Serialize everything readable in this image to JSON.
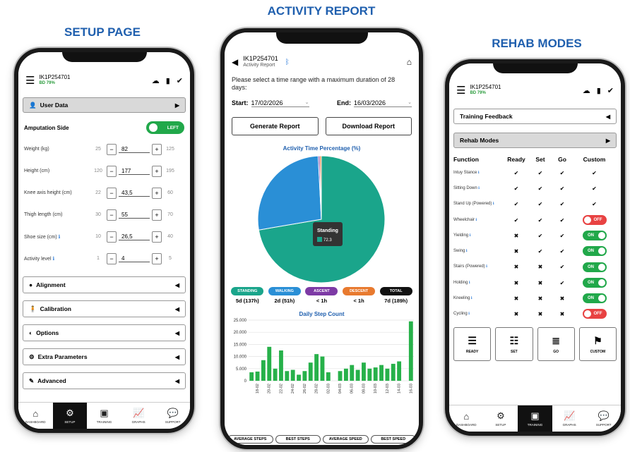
{
  "titles": {
    "setup": "SETUP PAGE",
    "activity": "ACTIVITY REPORT",
    "rehab": "REHAB MODES"
  },
  "device": {
    "id": "IK1P254701",
    "battery": "BD 79%"
  },
  "setup": {
    "user_data": "User Data",
    "amputation_side_label": "Amputation Side",
    "amputation_side_value": "LEFT",
    "params": [
      {
        "label": "Weight (kg)",
        "min": "25",
        "value": "82",
        "max": "125",
        "info": false
      },
      {
        "label": "Height (cm)",
        "min": "120",
        "value": "177",
        "max": "195",
        "info": false
      },
      {
        "label": "Knee axis height (cm)",
        "min": "22",
        "value": "43,5",
        "max": "60",
        "info": false
      },
      {
        "label": "Thigh length (cm)",
        "min": "30",
        "value": "55",
        "max": "70",
        "info": false
      },
      {
        "label": "Shoe size (cm)",
        "min": "10",
        "value": "26,5",
        "max": "40",
        "info": true
      },
      {
        "label": "Activity level",
        "min": "1",
        "value": "4",
        "max": "5",
        "info": true
      }
    ],
    "sections": [
      "Alignment",
      "Calibration",
      "Options",
      "Extra Parameters",
      "Advanced"
    ]
  },
  "nav": [
    {
      "label": "DASHBOARD",
      "icon": "home-icon"
    },
    {
      "label": "SETUP",
      "icon": "gear-icon"
    },
    {
      "label": "TRAINING",
      "icon": "training-icon"
    },
    {
      "label": "GRAPHS",
      "icon": "graph-icon"
    },
    {
      "label": "SUPPORT",
      "icon": "chat-icon"
    }
  ],
  "activity": {
    "subtitle": "Activity Report",
    "prompt": "Please select a time range with a maximum duration of 28 days:",
    "start_label": "Start:",
    "start_value": "17/02/2026",
    "end_label": "End:",
    "end_value": "16/03/2026",
    "generate": "Generate Report",
    "download": "Download Report",
    "pie_title": "Activity Time Percentage (%)",
    "tooltip_label": "Standing",
    "tooltip_value": "72.3",
    "summary": [
      {
        "label": "STANDING",
        "value": "5d (137h)",
        "color": "#1aa58b"
      },
      {
        "label": "WALKING",
        "value": "2d (51h)",
        "color": "#2a8fd6"
      },
      {
        "label": "ASCENT",
        "value": "< 1h",
        "color": "#7d3aa5"
      },
      {
        "label": "DESCENT",
        "value": "< 1h",
        "color": "#e87a2f"
      },
      {
        "label": "TOTAL",
        "value": "7d (189h)",
        "color": "#111111"
      }
    ],
    "bar_title": "Daily Step Count",
    "bottom_tabs": [
      "AVERAGE STEPS",
      "BEST STEPS",
      "AVERAGE SPEED",
      "BEST SPEED"
    ]
  },
  "rehab": {
    "training_feedback": "Training Feedback",
    "rehab_modes": "Rehab Modes",
    "headers": [
      "Function",
      "Ready",
      "Set",
      "Go",
      "Custom"
    ],
    "rows": [
      {
        "name": "Intuy Stance",
        "ready": "✔",
        "set": "✔",
        "go": "✔",
        "custom": "✔"
      },
      {
        "name": "Sitting Down",
        "ready": "✔",
        "set": "✔",
        "go": "✔",
        "custom": "✔"
      },
      {
        "name": "Stand Up (Powered)",
        "ready": "✔",
        "set": "✔",
        "go": "✔",
        "custom": "✔"
      },
      {
        "name": "Wheelchair",
        "ready": "✔",
        "set": "✔",
        "go": "✔",
        "custom": "OFF"
      },
      {
        "name": "Yielding",
        "ready": "✖",
        "set": "✔",
        "go": "✔",
        "custom": "ON"
      },
      {
        "name": "Swing",
        "ready": "✖",
        "set": "✔",
        "go": "✔",
        "custom": "ON"
      },
      {
        "name": "Stairs (Powered)",
        "ready": "✖",
        "set": "✖",
        "go": "✔",
        "custom": "ON"
      },
      {
        "name": "Holding",
        "ready": "✖",
        "set": "✖",
        "go": "✔",
        "custom": "ON"
      },
      {
        "name": "Kneeling",
        "ready": "✖",
        "set": "✖",
        "go": "✖",
        "custom": "ON"
      },
      {
        "name": "Cycling",
        "ready": "✖",
        "set": "✖",
        "go": "✖",
        "custom": "OFF"
      }
    ],
    "modes": [
      "READY",
      "SET",
      "GO",
      "CUSTOM"
    ]
  },
  "colors": {
    "accent": "#1f5fae",
    "on": "#21a84a",
    "off": "#e84242",
    "standing": "#1aa58b",
    "walking": "#2a8fd6"
  },
  "chart_data": [
    {
      "type": "pie",
      "title": "Activity Time Percentage (%)",
      "labels": [
        "Standing",
        "Walking",
        "Ascent",
        "Descent"
      ],
      "values": [
        72.3,
        26.9,
        0.4,
        0.4
      ]
    },
    {
      "type": "bar",
      "title": "Daily Step Count",
      "categories": [
        "17-02",
        "18-02",
        "19-02",
        "20-02",
        "21-02",
        "22-02",
        "23-02",
        "24-02",
        "25-02",
        "26-02",
        "27-02",
        "28-02",
        "01-03",
        "02-03",
        "03-03",
        "04-03",
        "05-03",
        "06-03",
        "07-03",
        "08-03",
        "09-03",
        "10-03",
        "11-03",
        "12-03",
        "13-03",
        "14-03",
        "15-03",
        "16-03"
      ],
      "values": [
        3500,
        3800,
        8500,
        14000,
        5000,
        12500,
        4000,
        4500,
        2500,
        4000,
        7500,
        11000,
        10000,
        3500,
        0,
        4000,
        5000,
        6500,
        4500,
        7500,
        5000,
        5500,
        6500,
        5000,
        7000,
        8000,
        0,
        24500
      ],
      "yticks": [
        0,
        5000,
        10000,
        15000,
        20000,
        25000
      ],
      "ytick_labels": [
        "0",
        "5.000",
        "10.000",
        "15.000",
        "20.000",
        "25.000"
      ],
      "xtick_labels": [
        "18-02",
        "20-02",
        "22-02",
        "24-02",
        "26-02",
        "28-02",
        "02-03",
        "04-03",
        "06-03",
        "08-03",
        "10-03",
        "12-03",
        "14-03",
        "16-03"
      ],
      "ylim": [
        0,
        25000
      ]
    }
  ]
}
